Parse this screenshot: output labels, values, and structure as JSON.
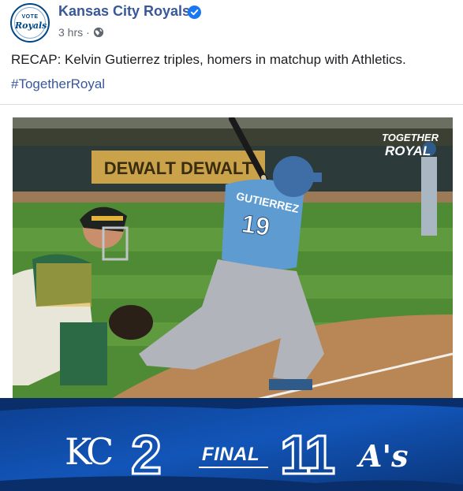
{
  "post": {
    "page_name": "Kansas City Royals",
    "time": "3 hrs",
    "separator": "·",
    "text": "RECAP: Kelvin Gutierrez triples, homers in matchup with Athletics.",
    "hashtag": "#TogetherRoyal"
  },
  "avatar": {
    "top": "VOTE",
    "bottom": "Royals"
  },
  "photo": {
    "banner_line1": "TOGETHER",
    "banner_line2": "ROYAL",
    "jersey_name": "GUTIERREZ",
    "jersey_number": "19",
    "wall_ad": "DEWALT DEWALT"
  },
  "score": {
    "home_team_logo": "KC",
    "home_score": "2",
    "status": "FINAL",
    "away_score": "11",
    "away_team_logo": "A's"
  },
  "icons": [
    "verified-badge-icon",
    "globe-icon"
  ],
  "colors": {
    "name": "#385898",
    "royal_blue": "#004687",
    "score_bg": "#0b3d91"
  }
}
